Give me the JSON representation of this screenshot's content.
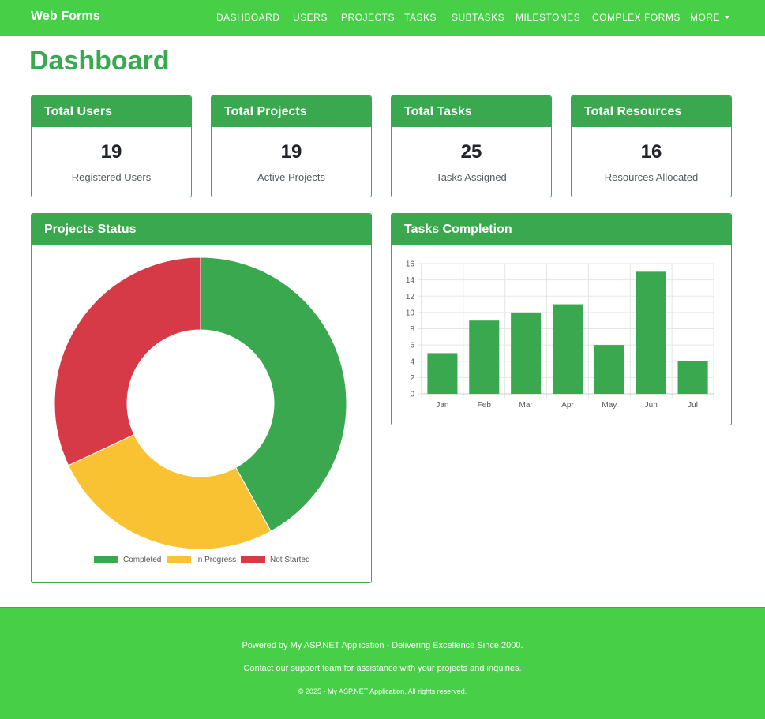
{
  "brand": "Web Forms",
  "nav": [
    "DASHBOARD",
    "USERS",
    "PROJECTS",
    "TASKS",
    "SUBTASKS",
    "MILESTONES",
    "COMPLEX FORMS",
    "MORE"
  ],
  "page_title": "Dashboard",
  "stats": [
    {
      "title": "Total Users",
      "value": "19",
      "label": "Registered Users"
    },
    {
      "title": "Total Projects",
      "value": "19",
      "label": "Active Projects"
    },
    {
      "title": "Total Tasks",
      "value": "25",
      "label": "Tasks Assigned"
    },
    {
      "title": "Total Resources",
      "value": "16",
      "label": "Resources Allocated"
    }
  ],
  "projects_status": {
    "title": "Projects Status"
  },
  "tasks_completion": {
    "title": "Tasks Completion"
  },
  "colors": {
    "navbar": "#47cf47",
    "card": "#3aa84f",
    "completed": "#3aa84f",
    "in_progress": "#f9c232",
    "not_started": "#d63a47"
  },
  "chart_data": [
    {
      "type": "pie",
      "labels": [
        "Completed",
        "In Progress",
        "Not Started"
      ],
      "values": [
        42,
        26,
        32
      ],
      "colors": [
        "#3aa84f",
        "#f9c232",
        "#d63a47"
      ],
      "legend": "bottom"
    },
    {
      "type": "bar",
      "categories": [
        "Jan",
        "Feb",
        "Mar",
        "Apr",
        "May",
        "Jun",
        "Jul"
      ],
      "values": [
        5,
        9,
        10,
        11,
        6,
        15,
        4
      ],
      "ylim": [
        0,
        16
      ],
      "yticks": [
        0,
        2,
        4,
        6,
        8,
        10,
        12,
        14,
        16
      ],
      "color": "#3aa84f",
      "grid": true
    }
  ],
  "footer": {
    "line1": "Powered by My ASP.NET Application - Delivering Excellence Since 2000.",
    "line2": "Contact our support team for assistance with your projects and inquiries.",
    "line3": "© 2025 - My ASP.NET Application. All rights reserved."
  }
}
